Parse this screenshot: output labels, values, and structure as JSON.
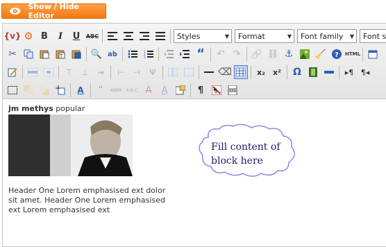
{
  "toggle": {
    "label": "Show / Hide Editor"
  },
  "toolbar": {
    "bold_label": "B",
    "italic_label": "I",
    "underline_label": "U",
    "strike_label": "ABC",
    "styles": "Styles",
    "format": "Format",
    "font_family": "Font family",
    "font_size": "Font size",
    "html_label": "HTML",
    "sub_label": "x₂",
    "sup_label": "x²",
    "omega_label": "Ω",
    "pilcrow_label": "¶",
    "quote_label": "“",
    "ins_label": "ins",
    "abbr_label": "ABBR.",
    "acronym_label": "A.B.C.",
    "font_a_label": "A"
  },
  "content": {
    "module_name": "jm methys",
    "module_tag": "popular",
    "paragraph": "Header One Lorem emphasised ext dolor sit amet. Header One Lorem emphasised ext Lorem emphasised ext",
    "bubble_text": "Fill content of block here"
  },
  "colors": {
    "accent": "#f27a10",
    "bubble_stroke": "#8a8ae6",
    "bubble_text": "#1a1a6a"
  }
}
